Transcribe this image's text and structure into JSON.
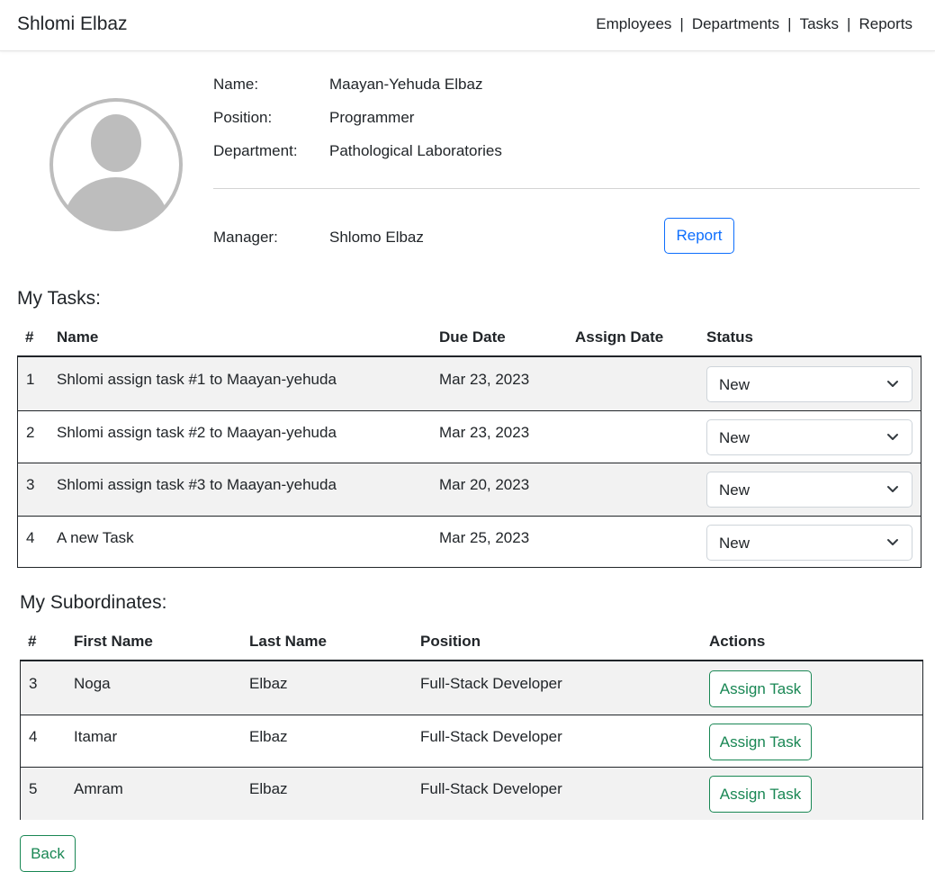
{
  "navbar": {
    "brand": "Shlomi Elbaz",
    "links": [
      "Employees",
      "Departments",
      "Tasks",
      "Reports"
    ],
    "separator": "|"
  },
  "profile": {
    "name_label": "Name:",
    "name_value": "Maayan-Yehuda Elbaz",
    "position_label": "Position:",
    "position_value": "Programmer",
    "department_label": "Department:",
    "department_value": "Pathological Laboratories",
    "manager_label": "Manager:",
    "manager_value": "Shlomo Elbaz",
    "report_button": "Report"
  },
  "tasks": {
    "title": "My Tasks:",
    "headers": [
      "#",
      "Name",
      "Due Date",
      "Assign Date",
      "Status"
    ],
    "rows": [
      {
        "num": "1",
        "name": "Shlomi assign task #1 to Maayan-yehuda",
        "due": "Mar 23, 2023",
        "assign": "",
        "status": "New"
      },
      {
        "num": "2",
        "name": "Shlomi assign task #2 to Maayan-yehuda",
        "due": "Mar 23, 2023",
        "assign": "",
        "status": "New"
      },
      {
        "num": "3",
        "name": "Shlomi assign task #3 to Maayan-yehuda",
        "due": "Mar 20, 2023",
        "assign": "",
        "status": "New"
      },
      {
        "num": "4",
        "name": "A new Task",
        "due": "Mar 25, 2023",
        "assign": "",
        "status": "New"
      }
    ]
  },
  "subordinates": {
    "title": "My Subordinates:",
    "headers": [
      "#",
      "First Name",
      "Last Name",
      "Position",
      "Actions"
    ],
    "rows": [
      {
        "num": "3",
        "first": "Noga",
        "last": "Elbaz",
        "position": "Full-Stack Developer",
        "action": "Assign Task"
      },
      {
        "num": "4",
        "first": "Itamar",
        "last": "Elbaz",
        "position": "Full-Stack Developer",
        "action": "Assign Task"
      },
      {
        "num": "5",
        "first": "Amram",
        "last": "Elbaz",
        "position": "Full-Stack Developer",
        "action": "Assign Task"
      }
    ]
  },
  "back_button": "Back",
  "colors": {
    "primary": "#0d6efd",
    "success": "#198754",
    "stripe": "#f2f2f2",
    "avatar": "#bdbdbd"
  },
  "icons": {
    "avatar": "user-avatar-icon",
    "select": "chevron-down-icon"
  }
}
